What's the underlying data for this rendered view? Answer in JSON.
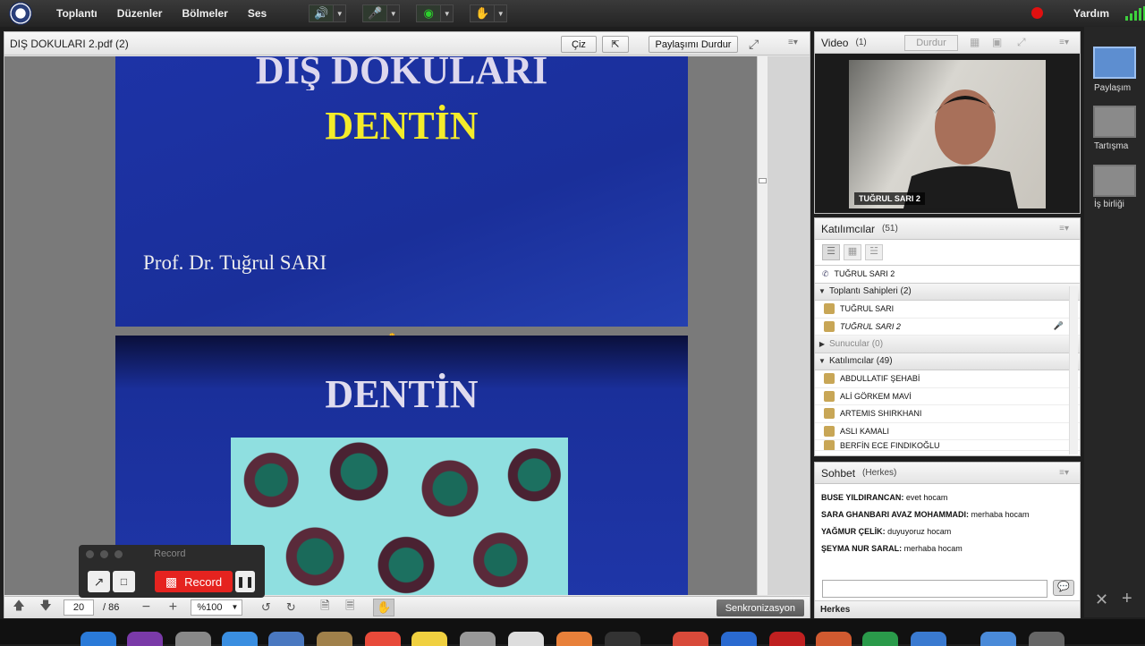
{
  "menu": [
    "Toplantı",
    "Düzenler",
    "Bölmeler",
    "Ses"
  ],
  "help": "Yardım",
  "share": {
    "title": "DIŞ DOKULARI 2.pdf (2)",
    "draw_label": "Çiz",
    "stop_label": "Paylaşımı Durdur",
    "slide1_title_a": "DIŞ DOKULARI",
    "slide1_title_b": "DENTİN",
    "slide1_author": "Prof. Dr. Tuğrul SARI",
    "slide2_title": "DENTİN",
    "page": "20",
    "total": "/ 86",
    "zoom": "%100",
    "sync_label": "Senkronizasyon"
  },
  "record": {
    "title": "Record",
    "button_label": "Record"
  },
  "video": {
    "title": "Video",
    "count": "(1)",
    "stop_label": "Durdur",
    "name": "TUĞRUL SARI 2"
  },
  "attendees": {
    "title": "Katılımcılar",
    "count": "(51)",
    "top_user": "TUĞRUL SARI 2",
    "hosts_label": "Toplantı Sahipleri (2)",
    "hosts": [
      "TUĞRUL SARI",
      "TUĞRUL SARI 2"
    ],
    "presenters_label": "Sunucular (0)",
    "participants_label": "Katılımcılar (49)",
    "participants": [
      "ABDULLATIF ŞEHABİ",
      "ALİ GÖRKEM MAVİ",
      "ARTEMIS SHIRKHANI",
      "ASLI KAMALI",
      "BERFİN ECE FINDIKOĞLU"
    ]
  },
  "chat": {
    "title": "Sohbet",
    "scope": "(Herkes)",
    "messages": [
      {
        "user": "BUSE YILDIRANCAN:",
        "text": " evet hocam"
      },
      {
        "user": "SARA GHANBARI AVAZ MOHAMMADI:",
        "text": " merhaba hocam"
      },
      {
        "user": "YAĞMUR ÇELİK:",
        "text": " duyuyoruz hocam"
      },
      {
        "user": "ŞEYMA NUR SARAL:",
        "text": " merhaba hocam"
      }
    ],
    "recipient": "Herkes"
  },
  "layouts": [
    "Paylaşım",
    "Tartışma",
    "İş birliği"
  ]
}
